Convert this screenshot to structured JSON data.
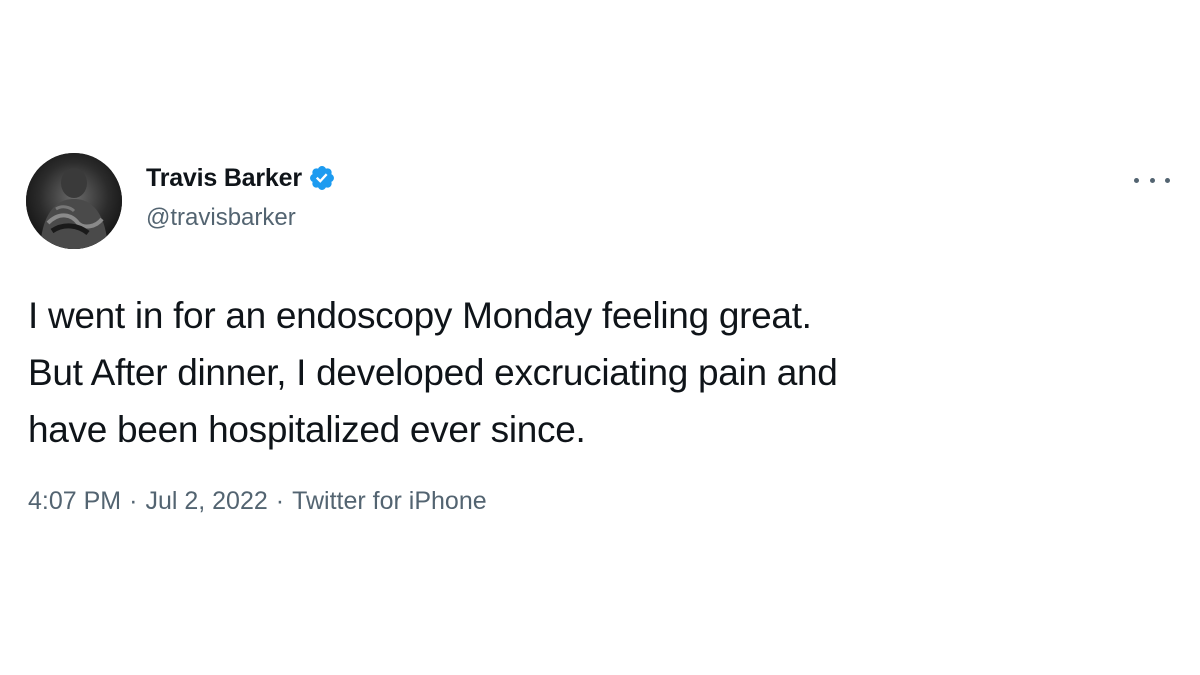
{
  "author": {
    "display_name": "Travis Barker",
    "handle": "@travisbarker",
    "verified": true,
    "verified_color": "#1d9bf0"
  },
  "tweet": {
    "lines": [
      "I went in for an endoscopy Monday feeling great.",
      "But After dinner, I developed excruciating pain and",
      "have been hospitalized ever since."
    ]
  },
  "meta": {
    "time": "4:07 PM",
    "separator": "·",
    "date": "Jul 2, 2022",
    "source": "Twitter for iPhone"
  },
  "icons": {
    "more": "more-options-icon",
    "verified": "verified-badge-icon"
  },
  "colors": {
    "text": "#0f1419",
    "secondary": "#536471",
    "accent": "#1d9bf0"
  }
}
